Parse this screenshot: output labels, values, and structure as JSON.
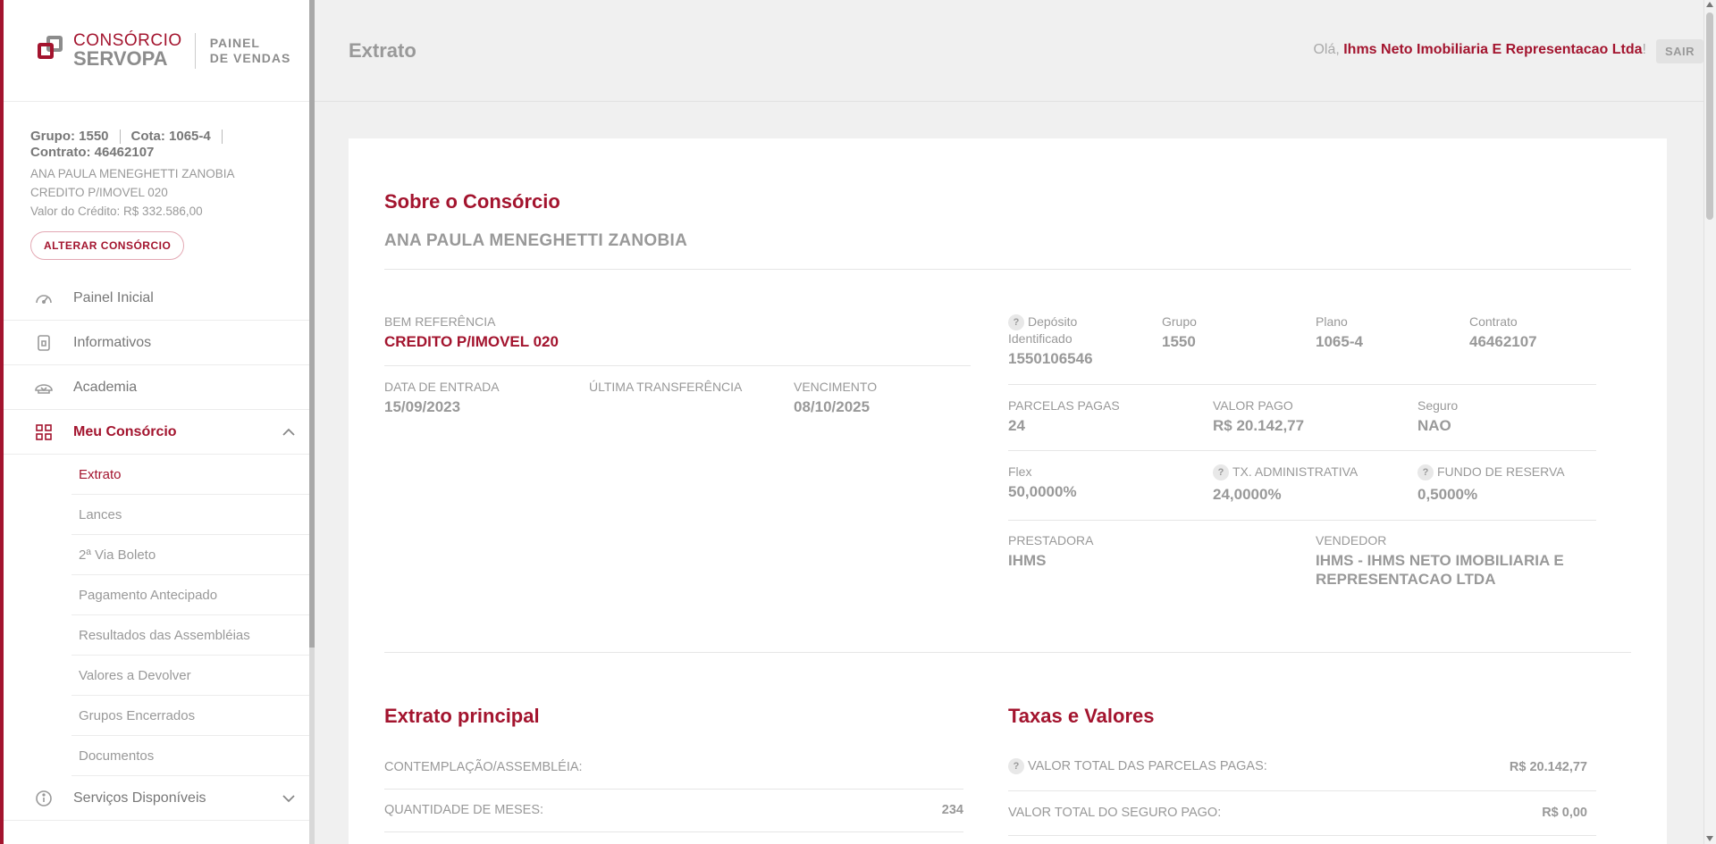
{
  "brand": {
    "logo_line1": "CONSÓRCIO",
    "logo_line2": "SERVOPA",
    "panel_line1": "PAINEL",
    "panel_line2": "DE VENDAS"
  },
  "consortium": {
    "group": "Grupo: 1550",
    "quota": "Cota: 1065-4",
    "contract": "Contrato: 46462107",
    "name": "ANA PAULA MENEGHETTI ZANOBIA",
    "product": "CREDITO P/IMOVEL 020",
    "credit_value": "Valor do Crédito: R$ 332.586,00",
    "change_button": "ALTERAR CONSÓRCIO"
  },
  "nav": {
    "painel": "Painel Inicial",
    "informativos": "Informativos",
    "academia": "Academia",
    "meu_consorcio": "Meu Consórcio",
    "sub": [
      "Extrato",
      "Lances",
      "2ª Via Boleto",
      "Pagamento Antecipado",
      "Resultados das Assembléias",
      "Valores a Devolver",
      "Grupos Encerrados",
      "Documentos"
    ],
    "servicos": "Serviços Disponíveis"
  },
  "header": {
    "title": "Extrato",
    "greeting": "Olá,",
    "user": "Ihms Neto Imobiliaria E Representacao Ltda",
    "greeting_end": "!",
    "logout": "SAIR"
  },
  "about": {
    "title": "Sobre o Consórcio",
    "owner": "ANA PAULA MENEGHETTI ZANOBIA",
    "bem_label": "BEM REFERÊNCIA",
    "bem_value": "CREDITO P/IMOVEL 020",
    "entrada_label": "DATA DE ENTRADA",
    "entrada_value": "15/09/2023",
    "transfer_label": "ÚLTIMA TRANSFERÊNCIA",
    "vencimento_label": "VENCIMENTO",
    "vencimento_value": "08/10/2025",
    "deposito_label": "Depósito Identificado",
    "deposito_value": "1550106546",
    "grupo_label": "Grupo",
    "grupo_value": "1550",
    "plano_label": "Plano",
    "plano_value": "1065-4",
    "contrato_label": "Contrato",
    "contrato_value": "46462107",
    "parcelas_label": "PARCELAS PAGAS",
    "parcelas_value": "24",
    "valor_pago_label": "VALOR PAGO",
    "valor_pago_value": "R$ 20.142,77",
    "seguro_label": "Seguro",
    "seguro_value": "NAO",
    "flex_label": "Flex",
    "flex_value": "50,0000%",
    "tx_label": "TX. ADMINISTRATIVA",
    "tx_value": "24,0000%",
    "fundo_label": "FUNDO DE RESERVA",
    "fundo_value": "0,5000%",
    "prestadora_label": "PRESTADORA",
    "prestadora_value": "IHMS",
    "vendedor_label": "VENDEDOR",
    "vendedor_value": "IHMS - IHMS NETO IMOBILIARIA E REPRESENTACAO LTDA"
  },
  "extrato": {
    "title": "Extrato principal",
    "row1_label": "CONTEMPLAÇÃO/ASSEMBLÉIA:",
    "row1_value": "",
    "row2_label": "QUANTIDADE DE MESES:",
    "row2_value": "234"
  },
  "taxas": {
    "title": "Taxas e Valores",
    "row1_label": "VALOR TOTAL DAS PARCELAS PAGAS:",
    "row1_value": "R$ 20.142,77",
    "row2_label": "VALOR TOTAL DO SEGURO PAGO:",
    "row2_value": "R$ 0,00"
  }
}
